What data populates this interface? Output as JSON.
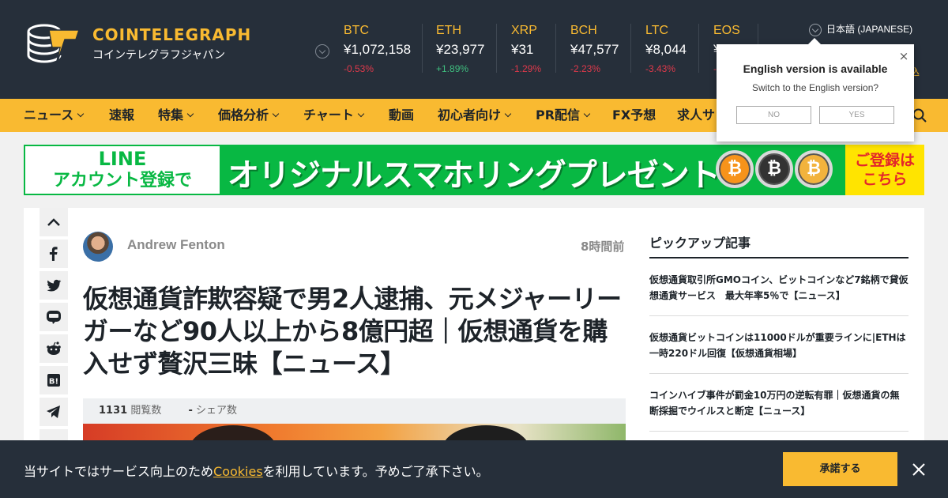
{
  "header": {
    "logo_name": "COINTELEGRAPH",
    "logo_sub": "コインテレグラフジャパン",
    "brand_color": "#f9ba31",
    "language_label": "日本語 (JAPANESE)",
    "partial_link": "込"
  },
  "tickers": [
    {
      "symbol": "BTC",
      "price": "¥1,072,158",
      "change": "-0.53%",
      "trend": "down"
    },
    {
      "symbol": "ETH",
      "price": "¥23,977",
      "change": "+1.89%",
      "trend": "up"
    },
    {
      "symbol": "XRP",
      "price": "¥31",
      "change": "-1.29%",
      "trend": "down"
    },
    {
      "symbol": "BCH",
      "price": "¥47,577",
      "change": "-2.23%",
      "trend": "down"
    },
    {
      "symbol": "LTC",
      "price": "¥8,044",
      "change": "-3.43%",
      "trend": "down"
    },
    {
      "symbol": "EOS",
      "price": "¥",
      "change": "-",
      "trend": "down"
    }
  ],
  "colors": {
    "down": "#e0394b",
    "up": "#3fbf7f"
  },
  "nav": {
    "items": [
      {
        "label": "ニュース",
        "dropdown": true
      },
      {
        "label": "速報",
        "dropdown": false
      },
      {
        "label": "特集",
        "dropdown": true
      },
      {
        "label": "価格分析",
        "dropdown": true
      },
      {
        "label": "チャート",
        "dropdown": true
      },
      {
        "label": "動画",
        "dropdown": false
      },
      {
        "label": "初心者向け",
        "dropdown": true
      },
      {
        "label": "PR配信",
        "dropdown": true
      },
      {
        "label": "FX予想",
        "dropdown": false
      },
      {
        "label": "求人サ",
        "dropdown": false
      }
    ]
  },
  "banner": {
    "left_line1": "LINE",
    "left_line2": "アカウント登録で",
    "main": "オリジナルスマホリングプレゼント",
    "coin_b": "₿",
    "right_line1": "ご登録は",
    "right_line2": "こちら"
  },
  "article": {
    "author": "Andrew Fenton",
    "time": "8時間前",
    "title": "仮想通貨詐欺容疑で男2人逮捕、元メジャーリーガーなど90人以上から8億円超｜仮想通貨を購入せず贅沢三昧【ニュース】",
    "views_count": "1131",
    "views_label": "閲覧数",
    "shares_count": "-",
    "shares_label": "シェア数"
  },
  "sidebar": {
    "title": "ピックアップ記事",
    "items": [
      "仮想通貨取引所GMOコイン、ビットコインなど7銘柄で貸仮想通貨サービス　最大年率5％で【ニュース】",
      "仮想通貨ビットコインは11000ドルが重要ラインに|ETHは一時220ドル回復【仮想通貨相場】",
      "コインハイブ事件が罰金10万円の逆転有罪｜仮想通貨の無断採掘でウイルスと断定【ニュース】"
    ]
  },
  "popup": {
    "title": "English version is available",
    "subtitle": "Switch to the English version?",
    "no": "NO",
    "yes": "YES",
    "close": "×"
  },
  "cookie": {
    "text_before": "当サイトではサービス向上のため",
    "link": "Cookies",
    "text_after": "を利用しています。予めご了承下さい。",
    "accept": "承諾する"
  }
}
